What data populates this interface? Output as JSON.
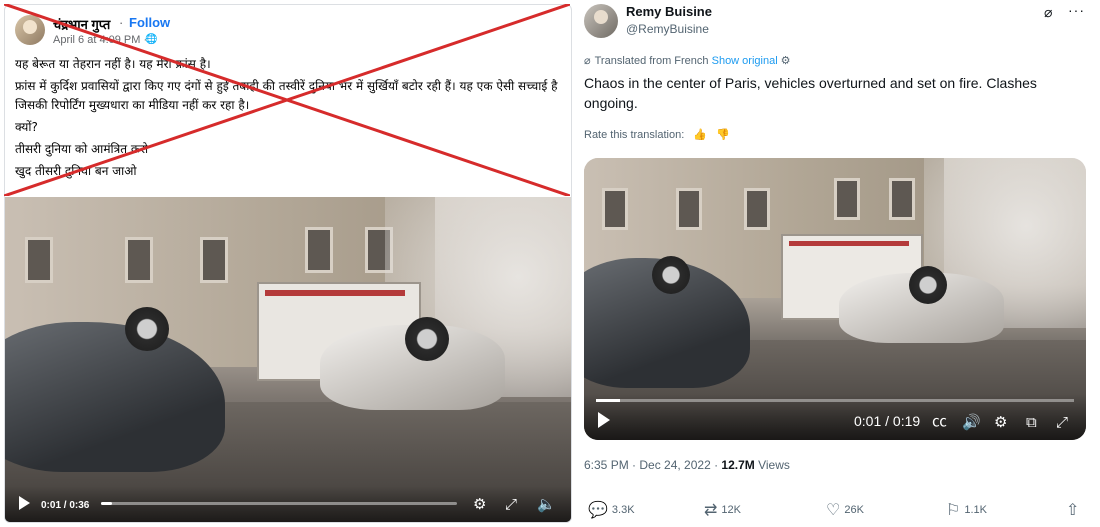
{
  "left_post": {
    "author": "चंद्रभान गुप्त",
    "separator": "·",
    "follow_label": "Follow",
    "timestamp": "April 6 at 4:09 PM · ",
    "audience_icon": "globe-icon",
    "text_lines": [
      "यह बेरूत या तेहरान नहीं है। यह मेरा फ्रांस है।",
      "फ्रांस में कुर्दिश प्रवासियों द्वारा किए गए दंगों से हुई तबाही की तस्वीरें दुनिया भर में सुर्खियाँ बटोर रही हैं। यह एक ऐसी सच्चाई है जिसकी रिपोर्टिंग मुख्यधारा का मीडिया नहीं कर रहा है।",
      "क्यों?",
      "तीसरी दुनिया को आमंत्रित करो",
      "खुद तीसरी दुनिया बन जाओ"
    ],
    "video": {
      "time": "0:01 / 0:36",
      "progress": 0.03,
      "controls": [
        "gear-icon",
        "fullscreen-icon",
        "volume-icon"
      ]
    },
    "overlay_color": "#d62b2b"
  },
  "right_post": {
    "display_name": "Remy Buisine",
    "handle": "@RemyBuisine",
    "header_icons": [
      "grok-icon",
      "more-icon"
    ],
    "translated_from": "Translated from French",
    "show_original": "Show original",
    "body": "Chaos in the center of Paris, vehicles overturned and set on fire. Clashes ongoing.",
    "rate_label": "Rate this translation:",
    "video": {
      "time": "0:01 / 0:19",
      "progress": 0.05,
      "controls": [
        "captions-icon",
        "volume-icon",
        "settings-icon",
        "pip-icon",
        "fullscreen-icon"
      ]
    },
    "time_date": "6:35 PM · Dec 24, 2022 · ",
    "views_count": "12.7M",
    "views_label": " Views",
    "actions": {
      "replies": "3.3K",
      "reposts": "12K",
      "likes": "26K",
      "bookmarks": "1.1K"
    },
    "accent": "#1d9bf0"
  }
}
